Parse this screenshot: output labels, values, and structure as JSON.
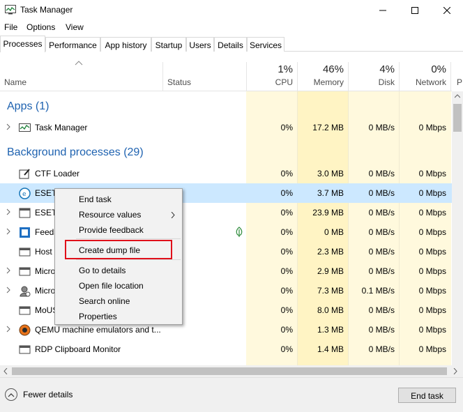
{
  "window": {
    "title": "Task Manager"
  },
  "menu": [
    "File",
    "Options",
    "View"
  ],
  "tabs": [
    "Processes",
    "Performance",
    "App history",
    "Startup",
    "Users",
    "Details",
    "Services"
  ],
  "columns": {
    "name": "Name",
    "status": "Status",
    "cpu": {
      "pct": "1%",
      "label": "CPU"
    },
    "memory": {
      "pct": "46%",
      "label": "Memory"
    },
    "disk": {
      "pct": "4%",
      "label": "Disk"
    },
    "network": {
      "pct": "0%",
      "label": "Network"
    },
    "next_partial": "P"
  },
  "groups": {
    "apps": "Apps (1)",
    "background": "Background processes (29)"
  },
  "rows": [
    {
      "name": "Task Manager",
      "icon": "task-manager-icon",
      "cpu": "0%",
      "memory": "17.2 MB",
      "disk": "0 MB/s",
      "network": "0 Mbps"
    },
    {
      "name": "CTF Loader",
      "icon": "ctf-loader-icon",
      "cpu": "0%",
      "memory": "3.0 MB",
      "disk": "0 MB/s",
      "network": "0 Mbps"
    },
    {
      "name": "ESET",
      "icon": "eset-icon",
      "cpu": "0%",
      "memory": "3.7 MB",
      "disk": "0 MB/s",
      "network": "0 Mbps"
    },
    {
      "name": "ESET",
      "icon": "eset-service-icon",
      "cpu": "0%",
      "memory": "23.9 MB",
      "disk": "0 MB/s",
      "network": "0 Mbps"
    },
    {
      "name": "Feeds",
      "icon": "feeds-icon",
      "cpu": "0%",
      "memory": "0 MB",
      "disk": "0 MB/s",
      "network": "0 Mbps"
    },
    {
      "name": "Host",
      "icon": "host-icon",
      "cpu": "0%",
      "memory": "2.3 MB",
      "disk": "0 MB/s",
      "network": "0 Mbps"
    },
    {
      "name": "Micro",
      "icon": "micro-icon",
      "cpu": "0%",
      "memory": "2.9 MB",
      "disk": "0 MB/s",
      "network": "0 Mbps"
    },
    {
      "name": "Micro",
      "icon": "micro-user-icon",
      "cpu": "0%",
      "memory": "7.3 MB",
      "disk": "0.1 MB/s",
      "network": "0 Mbps"
    },
    {
      "name": "MoUS",
      "icon": "mous-icon",
      "cpu": "0%",
      "memory": "8.0 MB",
      "disk": "0 MB/s",
      "network": "0 Mbps"
    },
    {
      "name": "QEMU machine emulators and t...",
      "icon": "qemu-icon",
      "cpu": "0%",
      "memory": "1.3 MB",
      "disk": "0 MB/s",
      "network": "0 Mbps"
    },
    {
      "name": "RDP Clipboard Monitor",
      "icon": "rdp-icon",
      "cpu": "0%",
      "memory": "1.4 MB",
      "disk": "0 MB/s",
      "network": "0 Mbps"
    }
  ],
  "context_menu": {
    "items": [
      "End task",
      "Resource values",
      "Provide feedback",
      "Create dump file",
      "Go to details",
      "Open file location",
      "Search online",
      "Properties"
    ]
  },
  "footer": {
    "fewer_details": "Fewer details",
    "end_task": "End task"
  },
  "colors": {
    "group_title": "#1e62b0",
    "selected_row": "#cce8ff",
    "highlight": "#e0101a",
    "heat_light": "#fff9dd",
    "heat_mem": "#fff4c4"
  }
}
